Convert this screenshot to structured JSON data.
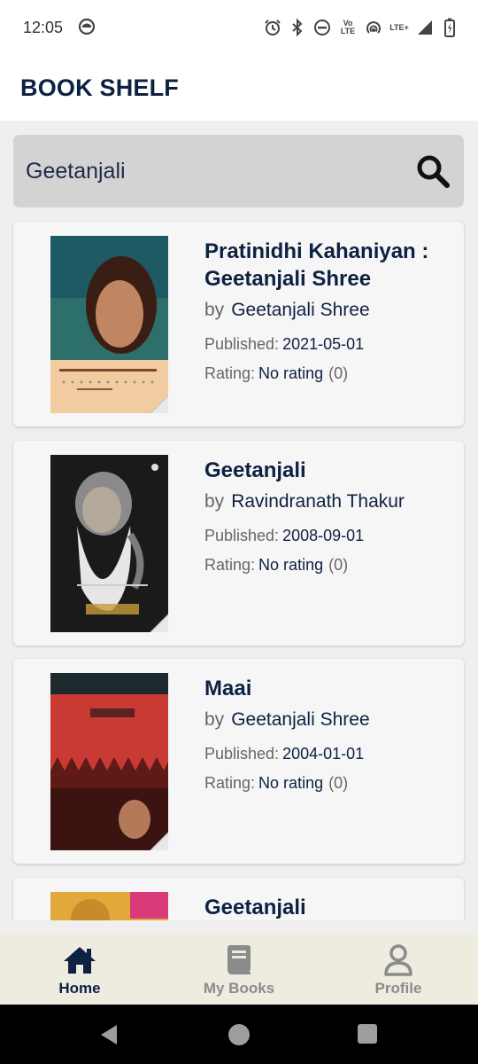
{
  "status_bar": {
    "time": "12:05",
    "icons": [
      "alarm-icon",
      "bluetooth-icon",
      "dnd-icon",
      "volte-icon",
      "hotspot-icon",
      "lte-icon",
      "signal-icon",
      "battery-icon"
    ],
    "volte_text": "Vo LTE",
    "lte_text": "LTE+"
  },
  "app_bar": {
    "title": "BOOK SHELF"
  },
  "search": {
    "value": "Geetanjali",
    "icon": "search-icon"
  },
  "books": [
    {
      "title": "Pratinidhi Kahaniyan : Geetanjali Shree",
      "by_label": "by",
      "author": "Geetanjali Shree",
      "published_label": "Published:",
      "published": "2021-05-01",
      "rating_label": "Rating:",
      "rating": "No rating",
      "rating_count": "(0)"
    },
    {
      "title": "Geetanjali",
      "by_label": "by",
      "author": "Ravindranath Thakur",
      "published_label": "Published:",
      "published": "2008-09-01",
      "rating_label": "Rating:",
      "rating": "No rating",
      "rating_count": "(0)"
    },
    {
      "title": "Maai",
      "by_label": "by",
      "author": "Geetanjali Shree",
      "published_label": "Published:",
      "published": "2004-01-01",
      "rating_label": "Rating:",
      "rating": "No rating",
      "rating_count": "(0)"
    },
    {
      "title": "Geetanjali"
    }
  ],
  "bottom_nav": {
    "items": [
      {
        "label": "Home",
        "icon": "home-icon",
        "active": true
      },
      {
        "label": "My Books",
        "icon": "book-icon",
        "active": false
      },
      {
        "label": "Profile",
        "icon": "user-icon",
        "active": false
      }
    ]
  },
  "colors": {
    "primary": "#0d2142",
    "search_bg": "#d3d3d3",
    "card_bg": "#f6f6f6",
    "nav_bg": "#eeebdf",
    "inactive": "#8b8b8b"
  }
}
